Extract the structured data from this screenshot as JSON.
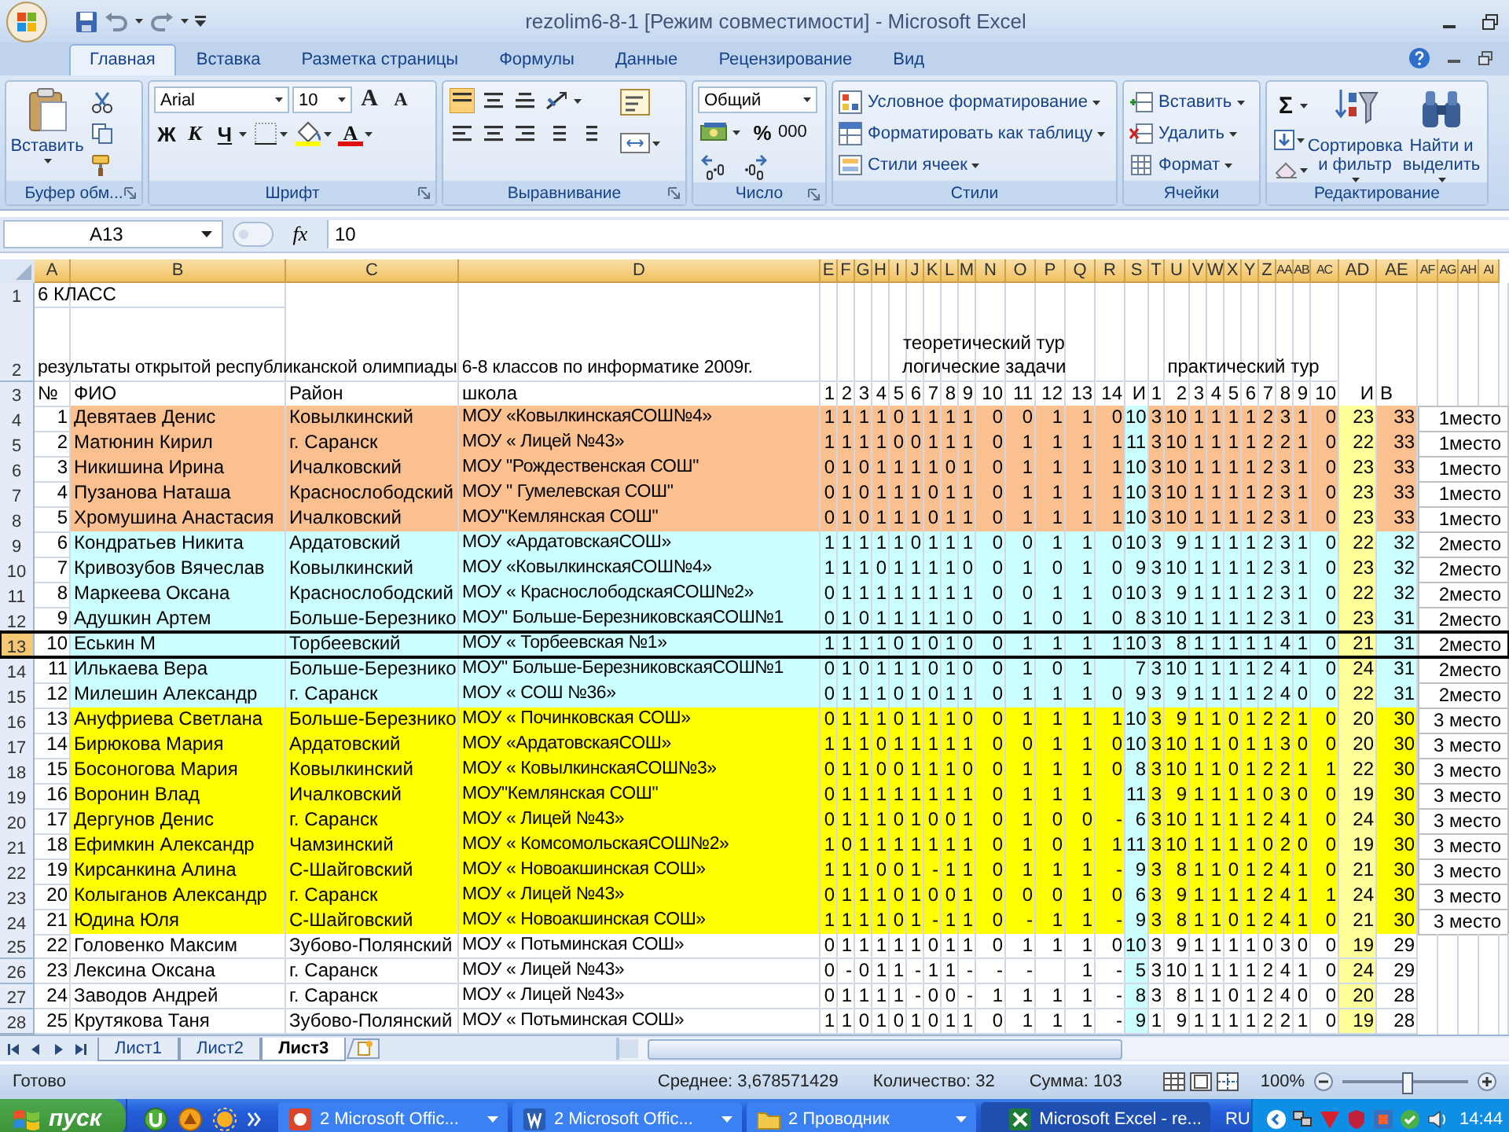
{
  "window": {
    "title": "rezolim6-8-1  [Режим совместимости] - Microsoft Excel"
  },
  "ribbon": {
    "tabs": [
      {
        "label": "Главная",
        "selected": true
      },
      {
        "label": "Вставка",
        "selected": false
      },
      {
        "label": "Разметка страницы",
        "selected": false
      },
      {
        "label": "Формулы",
        "selected": false
      },
      {
        "label": "Данные",
        "selected": false
      },
      {
        "label": "Рецензирование",
        "selected": false
      },
      {
        "label": "Вид",
        "selected": false
      }
    ],
    "clipboard": {
      "label": "Буфер обм...",
      "paste": "Вставить"
    },
    "font": {
      "label": "Шрифт",
      "font_name": "Arial",
      "font_size": "10",
      "grow": "A",
      "shrink": "A",
      "bold": "Ж",
      "italic": "К",
      "underline": "Ч",
      "font_color": "A"
    },
    "alignment": {
      "label": "Выравнивание"
    },
    "number": {
      "label": "Число",
      "format": "Общий",
      "percent": "%",
      "thousands": "000"
    },
    "styles": {
      "label": "Стили",
      "items": [
        "Условное форматирование",
        "Форматировать как таблицу",
        "Стили ячеек"
      ]
    },
    "cells": {
      "label": "Ячейки",
      "items": [
        "Вставить",
        "Удалить",
        "Формат"
      ]
    },
    "editing": {
      "label": "Редактирование",
      "sum": "Σ",
      "sort": "Сортировка и фильтр",
      "find": "Найти и выделить"
    }
  },
  "formula_bar": {
    "name_box": "A13",
    "function_symbol": "fx",
    "value": "10"
  },
  "sheet": {
    "columns": [
      "A",
      "B",
      "C",
      "D",
      "E",
      "F",
      "G",
      "H",
      "I",
      "J",
      "K",
      "L",
      "M",
      "N",
      "O",
      "P",
      "Q",
      "R",
      "S",
      "T",
      "U",
      "V",
      "W",
      "X",
      "Y",
      "Z",
      "AA",
      "AB",
      "AC",
      "AD",
      "AE",
      "AF",
      "AG",
      "AH",
      "AI"
    ],
    "row_labels": [
      "1",
      "2",
      "3",
      "4",
      "5",
      "6",
      "7",
      "8",
      "9",
      "10",
      "11",
      "12",
      "13",
      "14",
      "15",
      "16",
      "17",
      "18",
      "19",
      "20",
      "21",
      "22",
      "23",
      "24",
      "25",
      "26",
      "27",
      "28"
    ],
    "title": "6  КЛАСС",
    "subtitle": "результаты открытой  республиканской олимпиады 6-8 классов по информатике 2009г.",
    "theory_heading": "теоретический тур",
    "theory_subheading": "логические задачи",
    "practice_heading": "практический тур",
    "header": {
      "num": "№",
      "name": "ФИО",
      "district": "Район",
      "school": "школа",
      "theory": [
        "1",
        "2",
        "3",
        "4",
        "5",
        "6",
        "7",
        "8",
        "9",
        "10",
        "11",
        "12",
        "13",
        "14"
      ],
      "theory_total": "И",
      "practice": [
        "1",
        "2",
        "3",
        "4",
        "5",
        "6",
        "7",
        "8",
        "9",
        "10"
      ],
      "practice_total": "И",
      "total": "В"
    },
    "rows": [
      {
        "num": "1",
        "name": "Девятаев Денис",
        "district": "Ковылкинский",
        "school": "МОУ «КовылкинскаяСОШ№4»",
        "theory": [
          "1",
          "1",
          "1",
          "1",
          "0",
          "1",
          "1",
          "1",
          "1",
          "0",
          "0",
          "1",
          "1",
          "0"
        ],
        "theory_total": "10",
        "practice": [
          "3",
          "10",
          "1",
          "1",
          "1",
          "1",
          "2",
          "3",
          "1",
          "0"
        ],
        "practice_total": "23",
        "total": "33",
        "place": "1место",
        "color": "#fac090",
        "selected": false
      },
      {
        "num": "2",
        "name": "Матюнин Кирил",
        "district": "г. Саранск",
        "school": "МОУ « Лицей №43»",
        "theory": [
          "1",
          "1",
          "1",
          "1",
          "0",
          "0",
          "1",
          "1",
          "1",
          "0",
          "1",
          "1",
          "1",
          "1"
        ],
        "theory_total": "11",
        "practice": [
          "3",
          "10",
          "1",
          "1",
          "1",
          "1",
          "2",
          "2",
          "1",
          "0"
        ],
        "practice_total": "22",
        "total": "33",
        "place": "1место",
        "color": "#fac090",
        "selected": false
      },
      {
        "num": "3",
        "name": "Никишина Ирина",
        "district": "Ичалковский",
        "school": "МОУ \"Рождественская СОШ\"",
        "theory": [
          "0",
          "1",
          "0",
          "1",
          "1",
          "1",
          "1",
          "0",
          "1",
          "0",
          "1",
          "1",
          "1",
          "1"
        ],
        "theory_total": "10",
        "practice": [
          "3",
          "10",
          "1",
          "1",
          "1",
          "1",
          "2",
          "3",
          "1",
          "0"
        ],
        "practice_total": "23",
        "total": "33",
        "place": "1место",
        "color": "#fac090",
        "selected": false
      },
      {
        "num": "4",
        "name": "Пузанова Наташа",
        "district": "Краснослободский",
        "school": "МОУ \" Гумелевская СОШ\"",
        "theory": [
          "0",
          "1",
          "0",
          "1",
          "1",
          "1",
          "0",
          "1",
          "1",
          "0",
          "1",
          "1",
          "1",
          "1"
        ],
        "theory_total": "10",
        "practice": [
          "3",
          "10",
          "1",
          "1",
          "1",
          "1",
          "2",
          "3",
          "1",
          "0"
        ],
        "practice_total": "23",
        "total": "33",
        "place": "1место",
        "color": "#fac090",
        "selected": false
      },
      {
        "num": "5",
        "name": "Хромушина Анастасия",
        "district": "Ичалковский",
        "school": "МОУ\"Кемлянская СОШ\"",
        "theory": [
          "0",
          "1",
          "0",
          "1",
          "1",
          "1",
          "0",
          "1",
          "1",
          "0",
          "1",
          "1",
          "1",
          "1"
        ],
        "theory_total": "10",
        "practice": [
          "3",
          "10",
          "1",
          "1",
          "1",
          "1",
          "2",
          "3",
          "1",
          "0"
        ],
        "practice_total": "23",
        "total": "33",
        "place": "1место",
        "color": "#fac090",
        "selected": false
      },
      {
        "num": "6",
        "name": "Кондратьев Никита",
        "district": "Ардатовский",
        "school": "МОУ «АрдатовскаяСОШ»",
        "theory": [
          "1",
          "1",
          "1",
          "1",
          "1",
          "0",
          "1",
          "1",
          "1",
          "0",
          "0",
          "1",
          "1",
          "0"
        ],
        "theory_total": "10",
        "practice": [
          "3",
          "9",
          "1",
          "1",
          "1",
          "1",
          "2",
          "3",
          "1",
          "0"
        ],
        "practice_total": "22",
        "total": "32",
        "place": "2место",
        "color": "#ccffff",
        "selected": false
      },
      {
        "num": "7",
        "name": "Кривозубов Вячеслав",
        "district": "Ковылкинский",
        "school": "МОУ «КовылкинскаяСОШ№4»",
        "theory": [
          "1",
          "1",
          "1",
          "0",
          "1",
          "1",
          "1",
          "1",
          "0",
          "0",
          "1",
          "0",
          "1",
          "0"
        ],
        "theory_total": "9",
        "practice": [
          "3",
          "10",
          "1",
          "1",
          "1",
          "1",
          "2",
          "3",
          "1",
          "0"
        ],
        "practice_total": "23",
        "total": "32",
        "place": "2место",
        "color": "#ccffff",
        "selected": false
      },
      {
        "num": "8",
        "name": "Маркеева Оксана",
        "district": "Краснослободский",
        "school": "МОУ « КраснослободскаяСОШ№2»",
        "theory": [
          "0",
          "1",
          "1",
          "1",
          "1",
          "1",
          "1",
          "1",
          "1",
          "0",
          "0",
          "1",
          "1",
          "0"
        ],
        "theory_total": "10",
        "practice": [
          "3",
          "9",
          "1",
          "1",
          "1",
          "1",
          "2",
          "3",
          "1",
          "0"
        ],
        "practice_total": "22",
        "total": "32",
        "place": "2место",
        "color": "#ccffff",
        "selected": false
      },
      {
        "num": "9",
        "name": "Адушкин Артем",
        "district": "Больше-Березнико",
        "school": "МОУ\" Больше-БерезниковскаяСОШ№1",
        "theory": [
          "0",
          "1",
          "0",
          "1",
          "1",
          "1",
          "1",
          "1",
          "0",
          "0",
          "1",
          "0",
          "1",
          "0"
        ],
        "theory_total": "8",
        "practice": [
          "3",
          "10",
          "1",
          "1",
          "1",
          "1",
          "2",
          "3",
          "1",
          "0"
        ],
        "practice_total": "23",
        "total": "31",
        "place": "2место",
        "color": "#ccffff",
        "selected": false
      },
      {
        "num": "10",
        "name": "Еськин М",
        "district": "Торбеевский",
        "school": "МОУ « Торбеевская №1»",
        "theory": [
          "1",
          "1",
          "1",
          "1",
          "0",
          "1",
          "0",
          "1",
          "0",
          "0",
          "1",
          "1",
          "1",
          "1"
        ],
        "theory_total": "10",
        "practice": [
          "3",
          "8",
          "1",
          "1",
          "1",
          "1",
          "1",
          "4",
          "1",
          "0"
        ],
        "practice_total": "21",
        "total": "31",
        "place": "2место",
        "color": "#ccffff",
        "selected": true
      },
      {
        "num": "11",
        "name": "Илькаева Вера",
        "district": "Больше-Березнико",
        "school": "МОУ\" Больше-БерезниковскаяСОШ№1",
        "theory": {
          "q1": "0",
          "q2": "1",
          "q3": "0",
          "q4": "1",
          "q5": "1",
          "q6": "1",
          "q7": "0",
          "q8": "1",
          "q9": "0",
          "q10": "0",
          "q11": "1",
          "q12": "0",
          "q13": "1"
        },
        "theory_total": "7",
        "practice": [
          "3",
          "10",
          "1",
          "1",
          "1",
          "1",
          "2",
          "4",
          "1",
          "0"
        ],
        "practice_total": "24",
        "total": "31",
        "place": "2место",
        "color": "#ccffff",
        "selected": false
      },
      {
        "num": "12",
        "name": "Милешин Александр",
        "district": "г. Саранск",
        "school": "МОУ « СОШ №36»",
        "theory": [
          "0",
          "1",
          "1",
          "1",
          "0",
          "1",
          "0",
          "1",
          "1",
          "0",
          "1",
          "1",
          "1",
          "0"
        ],
        "theory_total": "9",
        "practice": [
          "3",
          "9",
          "1",
          "1",
          "1",
          "1",
          "2",
          "4",
          "0",
          "0"
        ],
        "practice_total": "22",
        "total": "31",
        "place": "2место",
        "color": "#ccffff",
        "selected": false
      },
      {
        "num": "13",
        "name": "Ануфриева Светлана",
        "district": "Больше-Березнико",
        "school": "МОУ « Починковская СОШ»",
        "theory": [
          "0",
          "1",
          "1",
          "1",
          "0",
          "1",
          "1",
          "1",
          "0",
          "0",
          "1",
          "1",
          "1",
          "1"
        ],
        "theory_total": "10",
        "practice": [
          "3",
          "9",
          "1",
          "1",
          "0",
          "1",
          "2",
          "2",
          "1",
          "0"
        ],
        "practice_total": "20",
        "total": "30",
        "place": "3 место",
        "color": "#ffff00",
        "selected": false
      },
      {
        "num": "14",
        "name": "Бирюкова Мария",
        "district": "Ардатовский",
        "school": "МОУ «АрдатовскаяСОШ»",
        "theory": [
          "1",
          "1",
          "1",
          "0",
          "1",
          "1",
          "1",
          "1",
          "1",
          "0",
          "0",
          "1",
          "1",
          "0"
        ],
        "theory_total": "10",
        "practice": [
          "3",
          "10",
          "1",
          "1",
          "0",
          "1",
          "1",
          "3",
          "0",
          "0"
        ],
        "practice_total": "20",
        "total": "30",
        "place": "3 место",
        "color": "#ffff00",
        "selected": false
      },
      {
        "num": "15",
        "name": "Босоногова Мария",
        "district": "Ковылкинский",
        "school": "МОУ « КовылкинскаяСОШ№3»",
        "theory": [
          "0",
          "1",
          "1",
          "0",
          "0",
          "1",
          "1",
          "1",
          "0",
          "0",
          "1",
          "1",
          "1",
          "0"
        ],
        "theory_total": "8",
        "practice": [
          "3",
          "10",
          "1",
          "1",
          "0",
          "1",
          "2",
          "2",
          "1",
          "1"
        ],
        "practice_total": "22",
        "total": "30",
        "place": "3 место",
        "color": "#ffff00",
        "selected": false
      },
      {
        "num": "16",
        "name": "Воронин Влад",
        "district": "Ичалковский",
        "school": "МОУ\"Кемлянская СОШ\"",
        "theory": {
          "q1": "0",
          "q2": "1",
          "q3": "1",
          "q4": "1",
          "q5": "1",
          "q6": "1",
          "q7": "1",
          "q8": "1",
          "q9": "1",
          "q10": "0",
          "q11": "1",
          "q12": "1",
          "q13": "1"
        },
        "theory_total": "11",
        "practice": [
          "3",
          "9",
          "1",
          "1",
          "1",
          "1",
          "0",
          "3",
          "0",
          "0"
        ],
        "practice_total": "19",
        "total": "30",
        "place": "3 место",
        "color": "#ffff00",
        "selected": false
      },
      {
        "num": "17",
        "name": "Дергунов Денис",
        "district": "г. Саранск",
        "school": "МОУ « Лицей №43»",
        "theory": [
          "0",
          "1",
          "1",
          "1",
          "0",
          "1",
          "0",
          "0",
          "1",
          "0",
          "1",
          "0",
          "0",
          "-"
        ],
        "theory_total": "6",
        "practice": [
          "3",
          "10",
          "1",
          "1",
          "1",
          "1",
          "2",
          "4",
          "1",
          "0"
        ],
        "practice_total": "24",
        "total": "30",
        "place": "3 место",
        "color": "#ffff00",
        "selected": false
      },
      {
        "num": "18",
        "name": "Ефимкин Александр",
        "district": "Чамзинский",
        "school": "МОУ « КомсомольскаяСОШ№2»",
        "theory": [
          "1",
          "0",
          "1",
          "1",
          "1",
          "1",
          "1",
          "1",
          "1",
          "0",
          "1",
          "0",
          "1",
          "1"
        ],
        "theory_total": "11",
        "practice": [
          "3",
          "10",
          "1",
          "1",
          "1",
          "1",
          "0",
          "2",
          "0",
          "0"
        ],
        "practice_total": "19",
        "total": "30",
        "place": "3 место",
        "color": "#ffff00",
        "selected": false
      },
      {
        "num": "19",
        "name": "Кирсанкина Алина",
        "district": "С-Шайговский",
        "school": "МОУ « Новоакшинская СОШ»",
        "theory": [
          "1",
          "1",
          "1",
          "0",
          "0",
          "1",
          "-",
          "1",
          "1",
          "0",
          "1",
          "1",
          "1",
          "-"
        ],
        "theory_total": "9",
        "practice": [
          "3",
          "8",
          "1",
          "1",
          "0",
          "1",
          "2",
          "4",
          "1",
          "0"
        ],
        "practice_total": "21",
        "total": "30",
        "place": "3 место",
        "color": "#ffff00",
        "selected": false
      },
      {
        "num": "20",
        "name": "Колыганов Александр",
        "district": "г. Саранск",
        "school": "МОУ « Лицей №43»",
        "theory": [
          "0",
          "1",
          "1",
          "1",
          "0",
          "1",
          "0",
          "0",
          "1",
          "0",
          "0",
          "0",
          "1",
          "0"
        ],
        "theory_total": "6",
        "practice": [
          "3",
          "9",
          "1",
          "1",
          "1",
          "1",
          "2",
          "4",
          "1",
          "1"
        ],
        "practice_total": "24",
        "total": "30",
        "place": "3 место",
        "color": "#ffff00",
        "selected": false
      },
      {
        "num": "21",
        "name": "Юдина Юля",
        "district": "С-Шайговский",
        "school": "МОУ « Новоакшинская СОШ»",
        "theory": [
          "1",
          "1",
          "1",
          "1",
          "0",
          "1",
          "-",
          "1",
          "1",
          "0",
          "-",
          "1",
          "1",
          "-"
        ],
        "theory_total": "9",
        "practice": [
          "3",
          "8",
          "1",
          "1",
          "0",
          "1",
          "2",
          "4",
          "1",
          "0"
        ],
        "practice_total": "21",
        "total": "30",
        "place": "3 место",
        "color": "#ffff00",
        "selected": false
      },
      {
        "num": "22",
        "name": "Головенко Максим",
        "district": "Зубово-Полянский",
        "school": "МОУ « Потьминская СОШ»",
        "theory": [
          "0",
          "1",
          "1",
          "1",
          "1",
          "1",
          "0",
          "1",
          "1",
          "0",
          "1",
          "1",
          "1",
          "0"
        ],
        "theory_total": "10",
        "practice": [
          "3",
          "9",
          "1",
          "1",
          "1",
          "1",
          "0",
          "3",
          "0",
          "0"
        ],
        "practice_total": "19",
        "total": "29",
        "color": "#ffffff",
        "selected": false
      },
      {
        "num": "23",
        "name": "Лексина Оксана",
        "district": "г. Саранск",
        "school": "МОУ « Лицей №43»",
        "theory": {
          "q1": "0",
          "q2": "-",
          "q3": "0",
          "q4": "1",
          "q5": "1",
          "q6": "-",
          "q7": "1",
          "q8": "1",
          "q9": "-",
          "q10": "-",
          "q11": "-",
          "q13": "1",
          "q14": "-"
        },
        "theory_total": "5",
        "practice": [
          "3",
          "10",
          "1",
          "1",
          "1",
          "1",
          "2",
          "4",
          "1",
          "0"
        ],
        "practice_total": "24",
        "total": "29",
        "color": "#ffffff",
        "selected": false
      },
      {
        "num": "24",
        "name": "Заводов Андрей",
        "district": "г. Саранск",
        "school": "МОУ « Лицей №43»",
        "theory": [
          "0",
          "1",
          "1",
          "1",
          "1",
          "-",
          "0",
          "0",
          "-",
          "1",
          "1",
          "1",
          "1",
          "-"
        ],
        "theory_total": "8",
        "practice": [
          "3",
          "8",
          "1",
          "1",
          "0",
          "1",
          "2",
          "4",
          "0",
          "0"
        ],
        "practice_total": "20",
        "total": "28",
        "color": "#ffffff",
        "selected": false
      },
      {
        "num": "25",
        "name": "Крутякова Таня",
        "district": "Зубово-Полянский",
        "school": "МОУ « Потьминская СОШ»",
        "theory": [
          "1",
          "1",
          "0",
          "1",
          "0",
          "1",
          "0",
          "1",
          "1",
          "0",
          "1",
          "1",
          "1",
          "-"
        ],
        "theory_total": "9",
        "practice": [
          "1",
          "9",
          "1",
          "1",
          "1",
          "1",
          "2",
          "2",
          "1",
          "0"
        ],
        "practice_total": "19",
        "total": "28",
        "color": "#ffffff",
        "selected": false
      }
    ]
  },
  "sheet_tabs": [
    {
      "label": "Лист1",
      "selected": false
    },
    {
      "label": "Лист2",
      "selected": false
    },
    {
      "label": "Лист3",
      "selected": true
    }
  ],
  "status_bar": {
    "state": "Готово",
    "average": "Среднее: 3,678571429",
    "count": "Количество: 32",
    "sum": "Сумма: 103",
    "zoom": "100%",
    "zoom_slider": {
      "level": 0.5
    }
  },
  "taskbar": {
    "start": "пуск",
    "buttons": [
      {
        "label": "2 Microsoft Offic...",
        "kind": "group",
        "selected": false
      },
      {
        "label": "2 Microsoft Offic...",
        "kind": "group",
        "selected": false
      },
      {
        "label": "2 Проводник",
        "kind": "group",
        "selected": false
      },
      {
        "label": "Microsoft Excel - re...",
        "kind": "single",
        "selected": true
      }
    ],
    "language": "RU",
    "clock": "14:44"
  }
}
